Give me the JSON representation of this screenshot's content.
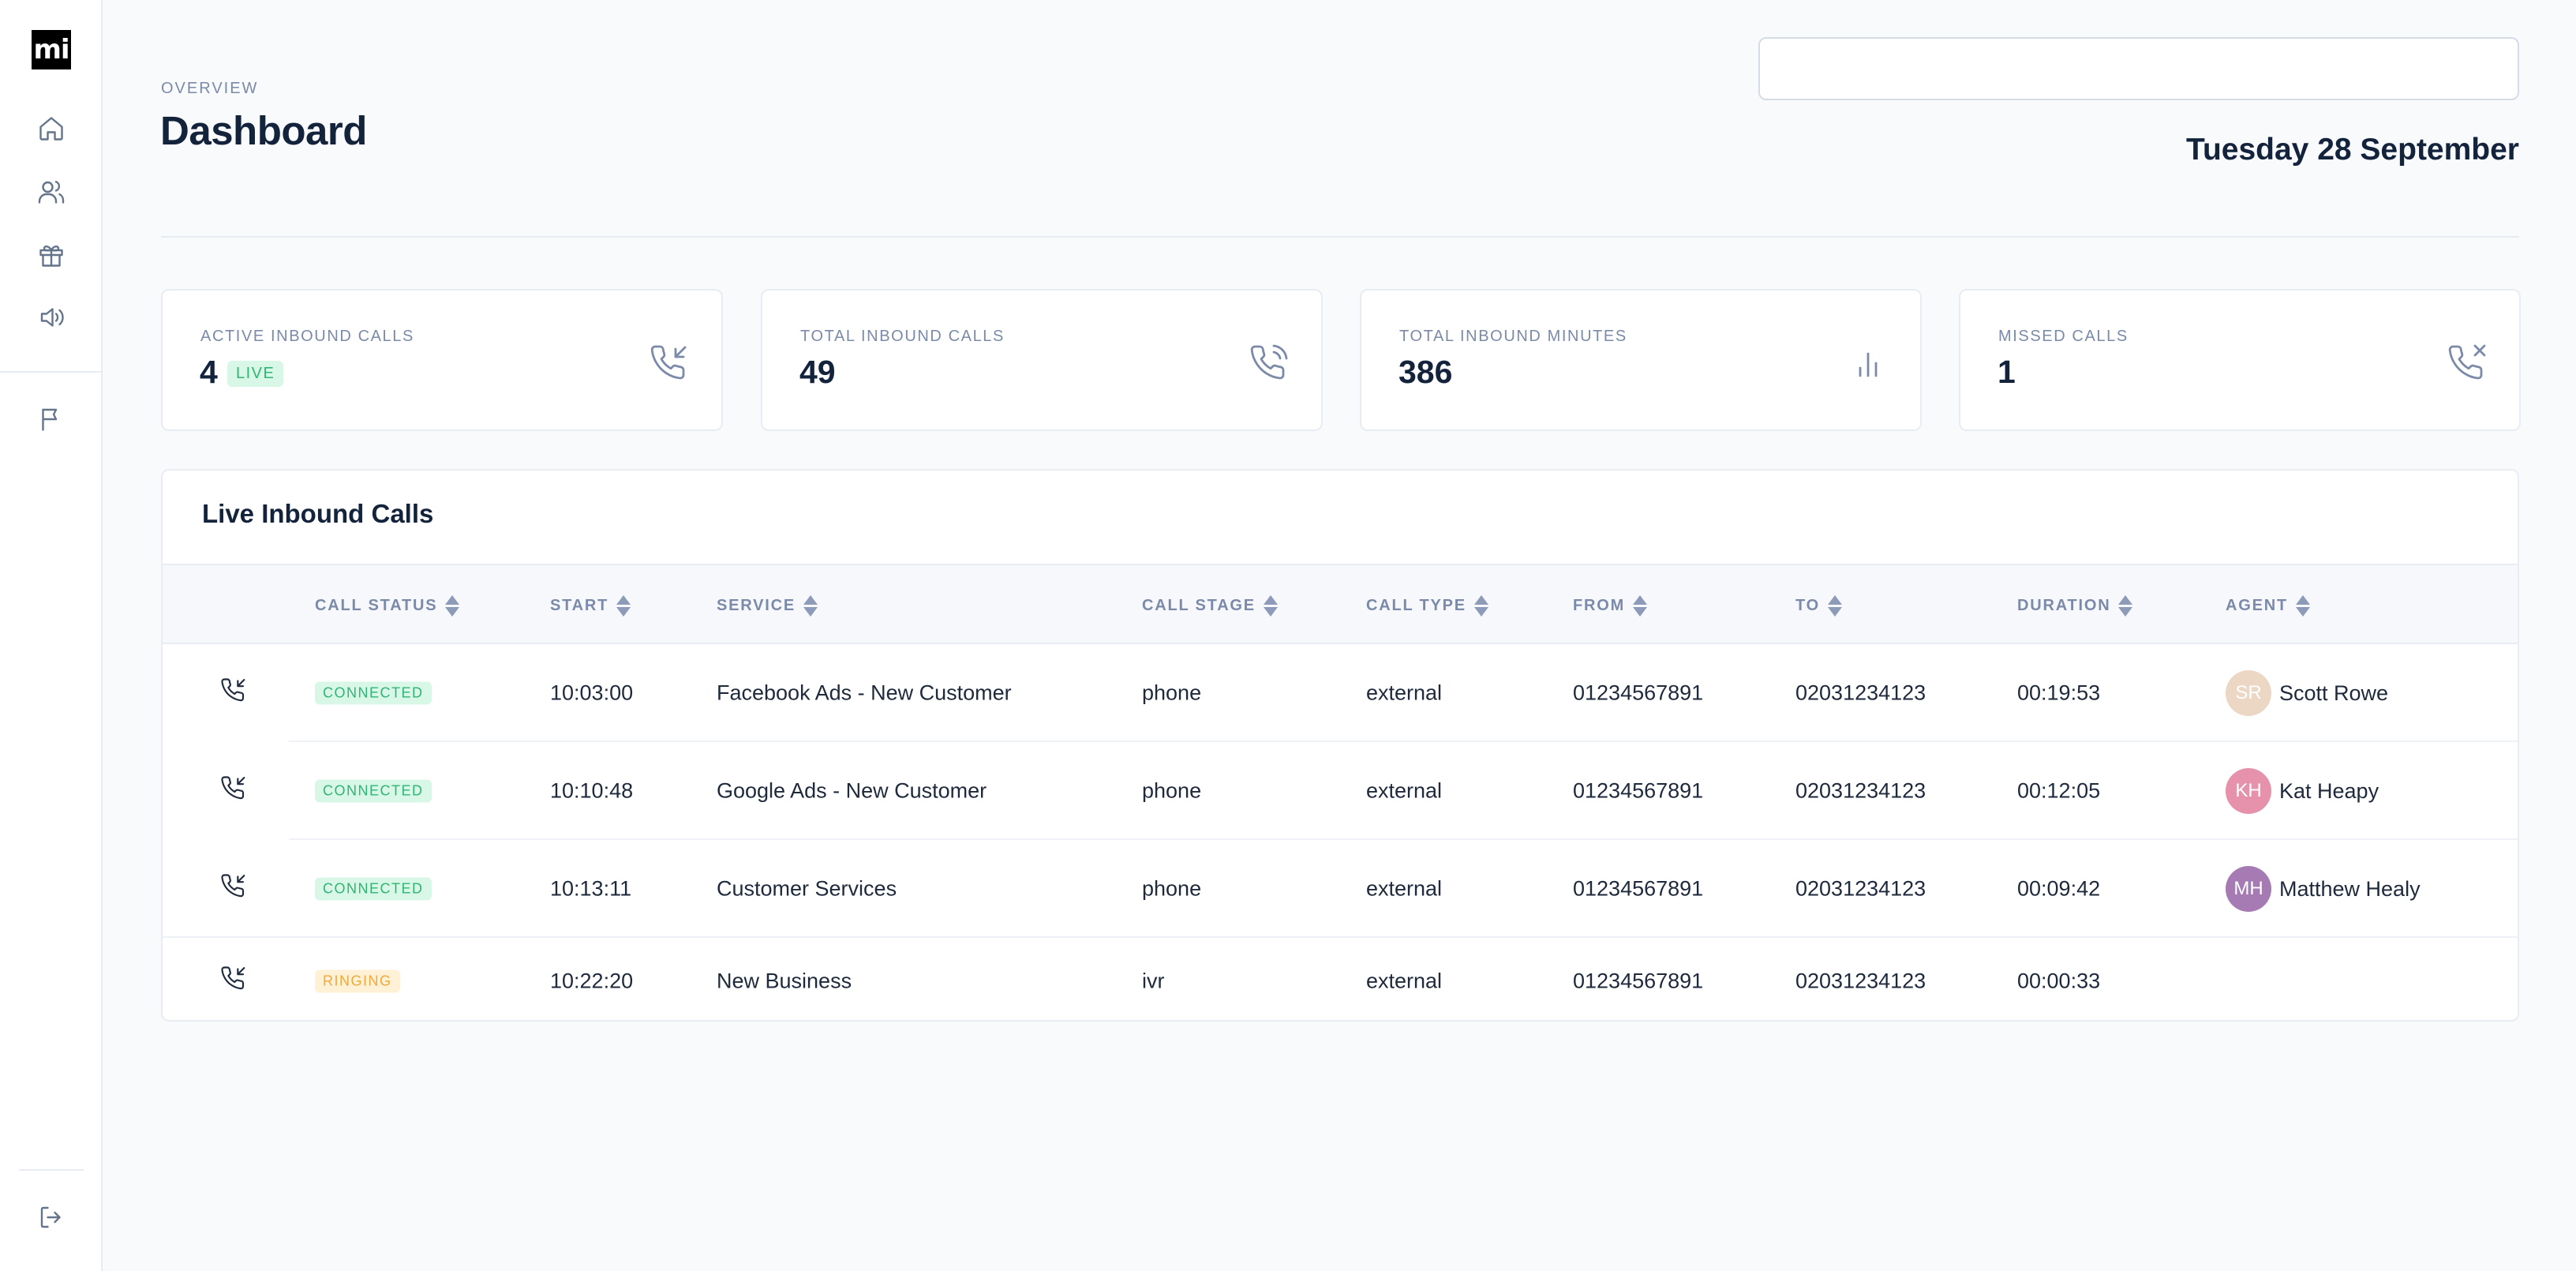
{
  "brand": {
    "logo_text": "mi"
  },
  "sidebar": {
    "items": [
      {
        "name": "home",
        "icon": "home-icon"
      },
      {
        "name": "users",
        "icon": "users-icon"
      },
      {
        "name": "gift",
        "icon": "gift-icon"
      },
      {
        "name": "announcements",
        "icon": "speaker-icon"
      },
      {
        "name": "reports",
        "icon": "flag-icon"
      }
    ],
    "logout_icon": "logout-icon"
  },
  "header": {
    "overline": "OVERVIEW",
    "title": "Dashboard",
    "search_value": "",
    "date": "Tuesday 28 September"
  },
  "stats": [
    {
      "label": "ACTIVE INBOUND CALLS",
      "value": "4",
      "badge": "LIVE",
      "icon": "phone-incoming-icon"
    },
    {
      "label": "TOTAL INBOUND CALLS",
      "value": "49",
      "icon": "phone-call-icon"
    },
    {
      "label": "TOTAL INBOUND MINUTES",
      "value": "386",
      "icon": "bar-chart-icon"
    },
    {
      "label": "MISSED CALLS",
      "value": "1",
      "icon": "phone-missed-icon"
    }
  ],
  "table": {
    "title": "Live Inbound Calls",
    "columns": [
      "CALL STATUS",
      "START",
      "SERVICE",
      "CALL STAGE",
      "CALL TYPE",
      "FROM",
      "TO",
      "DURATION",
      "AGENT"
    ],
    "rows": [
      {
        "status": "CONNECTED",
        "start": "10:03:00",
        "service": "Facebook Ads - New Customer",
        "stage": "phone",
        "type": "external",
        "from": "01234567891",
        "to": "02031234123",
        "duration": "00:19:53",
        "agent_initials": "SR",
        "agent": "Scott Rowe",
        "avatar_color": "#ecd6c4"
      },
      {
        "status": "CONNECTED",
        "start": "10:10:48",
        "service": "Google Ads - New Customer",
        "stage": "phone",
        "type": "external",
        "from": "01234567891",
        "to": "02031234123",
        "duration": "00:12:05",
        "agent_initials": "KH",
        "agent": "Kat Heapy",
        "avatar_color": "#e792ad"
      },
      {
        "status": "CONNECTED",
        "start": "10:13:11",
        "service": "Customer Services",
        "stage": "phone",
        "type": "external",
        "from": "01234567891",
        "to": "02031234123",
        "duration": "00:09:42",
        "agent_initials": "MH",
        "agent": "Matthew Healy",
        "avatar_color": "#a67bb4"
      },
      {
        "status": "RINGING",
        "start": "10:22:20",
        "service": "New Business",
        "stage": "ivr",
        "type": "external",
        "from": "01234567891",
        "to": "02031234123",
        "duration": "00:00:33",
        "agent_initials": "",
        "agent": "",
        "avatar_color": ""
      }
    ]
  },
  "colors": {
    "background": "#f8fafc",
    "text_primary": "#14233c",
    "text_muted": "#7b8aa8",
    "connected": "#2fb574",
    "ringing": "#f0a93b"
  }
}
